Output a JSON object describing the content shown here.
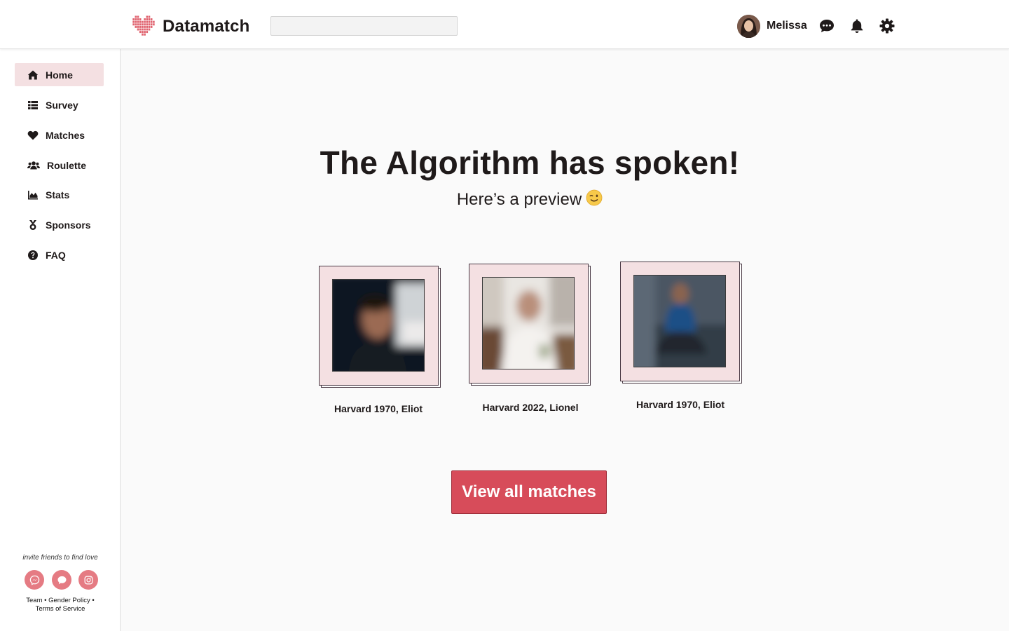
{
  "brand": {
    "name": "Datamatch",
    "logo_icon": "pixel-heart-icon",
    "color": "#e06470"
  },
  "header": {
    "search": {
      "value": "",
      "placeholder": ""
    },
    "user": {
      "name": "Melissa"
    },
    "icons": [
      "messages-icon",
      "bell-icon",
      "gear-icon"
    ]
  },
  "sidebar": {
    "items": [
      {
        "label": "Home",
        "icon": "home-icon",
        "active": true
      },
      {
        "label": "Survey",
        "icon": "list-icon",
        "active": false
      },
      {
        "label": "Matches",
        "icon": "heart-icon",
        "active": false
      },
      {
        "label": "Roulette",
        "icon": "users-icon",
        "active": false
      },
      {
        "label": "Stats",
        "icon": "area-chart-icon",
        "active": false
      },
      {
        "label": "Sponsors",
        "icon": "medal-icon",
        "active": false
      },
      {
        "label": "FAQ",
        "icon": "question-circle-icon",
        "active": false
      }
    ],
    "invite_text": "invite friends to find love",
    "social": [
      "messenger-icon",
      "message-bubble-icon",
      "instagram-icon"
    ],
    "footer": {
      "team": "Team",
      "gender_policy": "Gender Policy",
      "terms": "Terms of Service",
      "separator": "•"
    }
  },
  "main": {
    "title": "The Algorithm has spoken!",
    "subtitle": "Here’s a preview",
    "subtitle_emoji": "winking-face-icon",
    "matches": [
      {
        "caption": "Harvard 1970, Eliot"
      },
      {
        "caption": "Harvard 2022, Lionel"
      },
      {
        "caption": "Harvard 1970, Eliot"
      }
    ],
    "cta_label": "View all matches"
  },
  "colors": {
    "accent": "#d74c5a",
    "active_nav": "#f4e0e2",
    "card_bg": "#f4e0e2",
    "social": "#e57b83",
    "text": "#1f1a1a"
  }
}
